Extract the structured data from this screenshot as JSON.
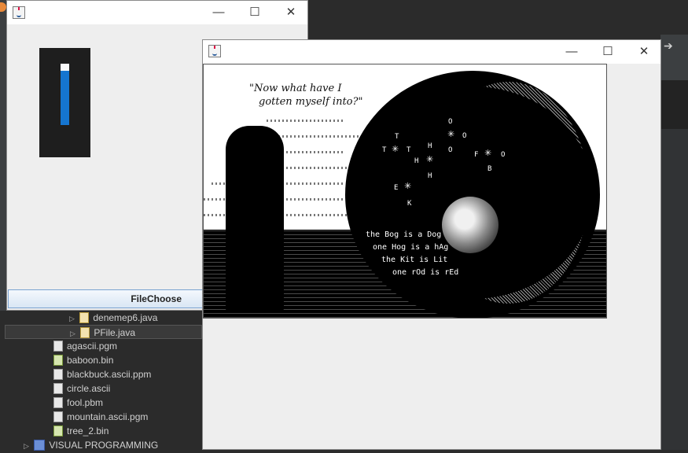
{
  "window1": {
    "meter_value": 0.88,
    "file_choose_label": "FileChoose"
  },
  "window2": {
    "image": {
      "quote_line1": "\"Now what have I",
      "quote_line2": "gotten myself into?\"",
      "star_letters": [
        "O",
        "O",
        "O",
        "T",
        "T",
        "T",
        "H",
        "H",
        "H",
        "F",
        "O",
        "B",
        "E",
        "K"
      ],
      "riddle": [
        "the Bog is a Dog",
        "one Hog is a hAg",
        "the Kit is Lit",
        "one rOd is rEd"
      ]
    }
  },
  "tree": {
    "items": [
      {
        "label": "denemep6.java",
        "type": "java",
        "expandable": true
      },
      {
        "label": "PFile.java",
        "type": "java",
        "expandable": true,
        "selected": true
      },
      {
        "label": "agascii.pgm",
        "type": "file"
      },
      {
        "label": "baboon.bin",
        "type": "bin"
      },
      {
        "label": "blackbuck.ascii.ppm",
        "type": "file"
      },
      {
        "label": "circle.ascii",
        "type": "file"
      },
      {
        "label": "fool.pbm",
        "type": "file"
      },
      {
        "label": "mountain.ascii.pgm",
        "type": "file"
      },
      {
        "label": "tree_2.bin",
        "type": "bin"
      },
      {
        "label": "VISUAL PROGRAMMING",
        "type": "project",
        "expandable": true
      }
    ]
  },
  "icons": {
    "window_icon": "java-app-icon",
    "minimize": "minimize-icon",
    "maximize": "maximize-icon",
    "close": "close-icon"
  }
}
